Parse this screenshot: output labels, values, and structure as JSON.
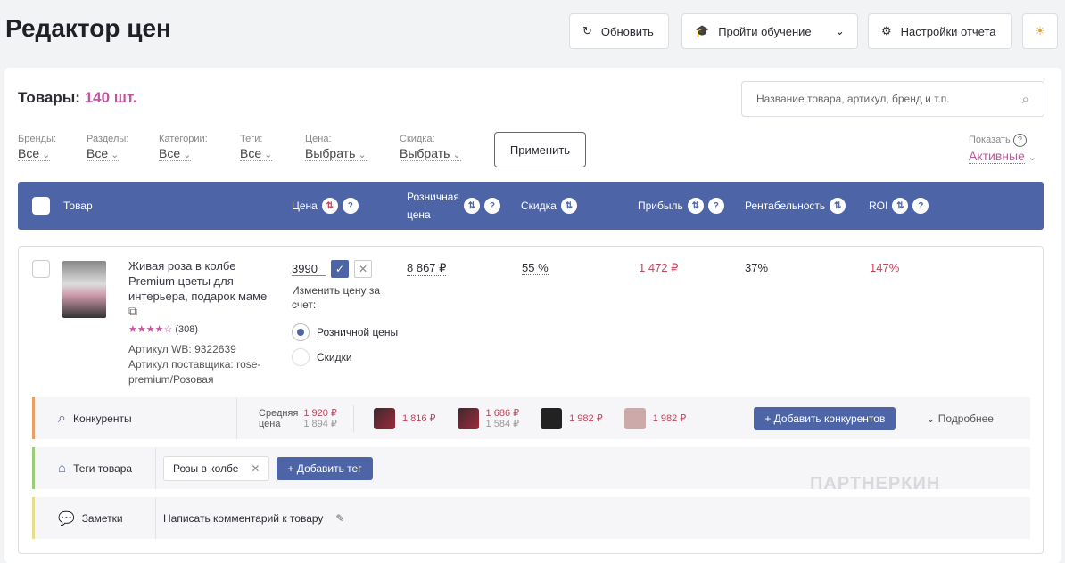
{
  "header": {
    "title": "Редактор цен",
    "refresh": "Обновить",
    "training": "Пройти обучение",
    "settings": "Настройки отчета"
  },
  "summary": {
    "label": "Товары:",
    "count": "140 шт."
  },
  "search": {
    "placeholder": "Название товара, артикул, бренд и т.п."
  },
  "filters": [
    {
      "label": "Бренды:",
      "value": "Все"
    },
    {
      "label": "Разделы:",
      "value": "Все"
    },
    {
      "label": "Категории:",
      "value": "Все"
    },
    {
      "label": "Теги:",
      "value": "Все"
    },
    {
      "label": "Цена:",
      "value": "Выбрать"
    },
    {
      "label": "Скидка:",
      "value": "Выбрать"
    }
  ],
  "apply": "Применить",
  "show": {
    "label": "Показать",
    "value": "Активные"
  },
  "columns": {
    "product": "Товар",
    "price": "Цена",
    "retail1": "Розничная",
    "retail2": "цена",
    "discount": "Скидка",
    "profit": "Прибыль",
    "profitability": "Рентабельность",
    "roi": "ROI"
  },
  "product": {
    "name": "Живая роза в колбе Premium цветы для интерьера, подарок маме",
    "reviews": "(308)",
    "rating": 4,
    "wb": "Артикул WB: 9322639",
    "supplier": "Артикул поставщика: rose-premium/Розовая",
    "price_input": "3990",
    "change_label": "Изменить цену за счет:",
    "opt1": "Розничной цены",
    "opt2": "Скидки",
    "retail": "8 867 ₽",
    "discount": "55 %",
    "profit": "1 472 ₽",
    "profitability": "37%",
    "roi": "147%"
  },
  "competitors": {
    "label": "Конкуренты",
    "avg1": "Средняя",
    "avg2": "цена",
    "avg_price": "1 920 ₽",
    "avg_old": "1 894 ₽",
    "items": [
      {
        "price": "1 816 ₽",
        "old": ""
      },
      {
        "price": "1 686 ₽",
        "old": "1 584 ₽"
      },
      {
        "price": "1 982 ₽",
        "old": ""
      },
      {
        "price": "1 982 ₽",
        "old": ""
      }
    ],
    "add": "+ Добавить конкурентов",
    "more": "Подробнее"
  },
  "tags": {
    "label": "Теги товара",
    "tag": "Розы в колбе",
    "add": "+ Добавить тег"
  },
  "notes": {
    "label": "Заметки",
    "placeholder": "Написать комментарий к товару"
  },
  "watermark": "ПАРТНЕРКИН"
}
